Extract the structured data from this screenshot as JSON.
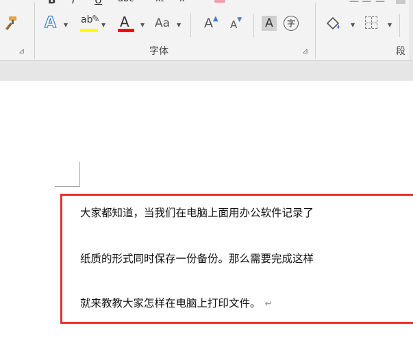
{
  "ribbon": {
    "font_group": {
      "label": "字体",
      "text_effects_glyph": "A",
      "highlight_glyph": "ab",
      "font_color_glyph": "A",
      "change_case_label": "Aa",
      "grow_font_glyph": "A",
      "shrink_font_glyph": "A",
      "char_shading_glyph": "A",
      "enclose_char_glyph": "字"
    },
    "paragraph_group": {
      "label": "段"
    },
    "colors": {
      "highlight_bar": "#ffff00",
      "font_color_bar": "#ff0000",
      "text_effects": "#3d7bd6"
    }
  },
  "document": {
    "lines": [
      "大家都知道，当我们在电脑上面用办公软件记录了",
      "纸质的形式同时保存一份备份。那么需要完成这样",
      "就来教教大家怎样在电脑上打印文件。"
    ],
    "paragraph_mark": "↵",
    "highlight_color": "#e8312f"
  }
}
